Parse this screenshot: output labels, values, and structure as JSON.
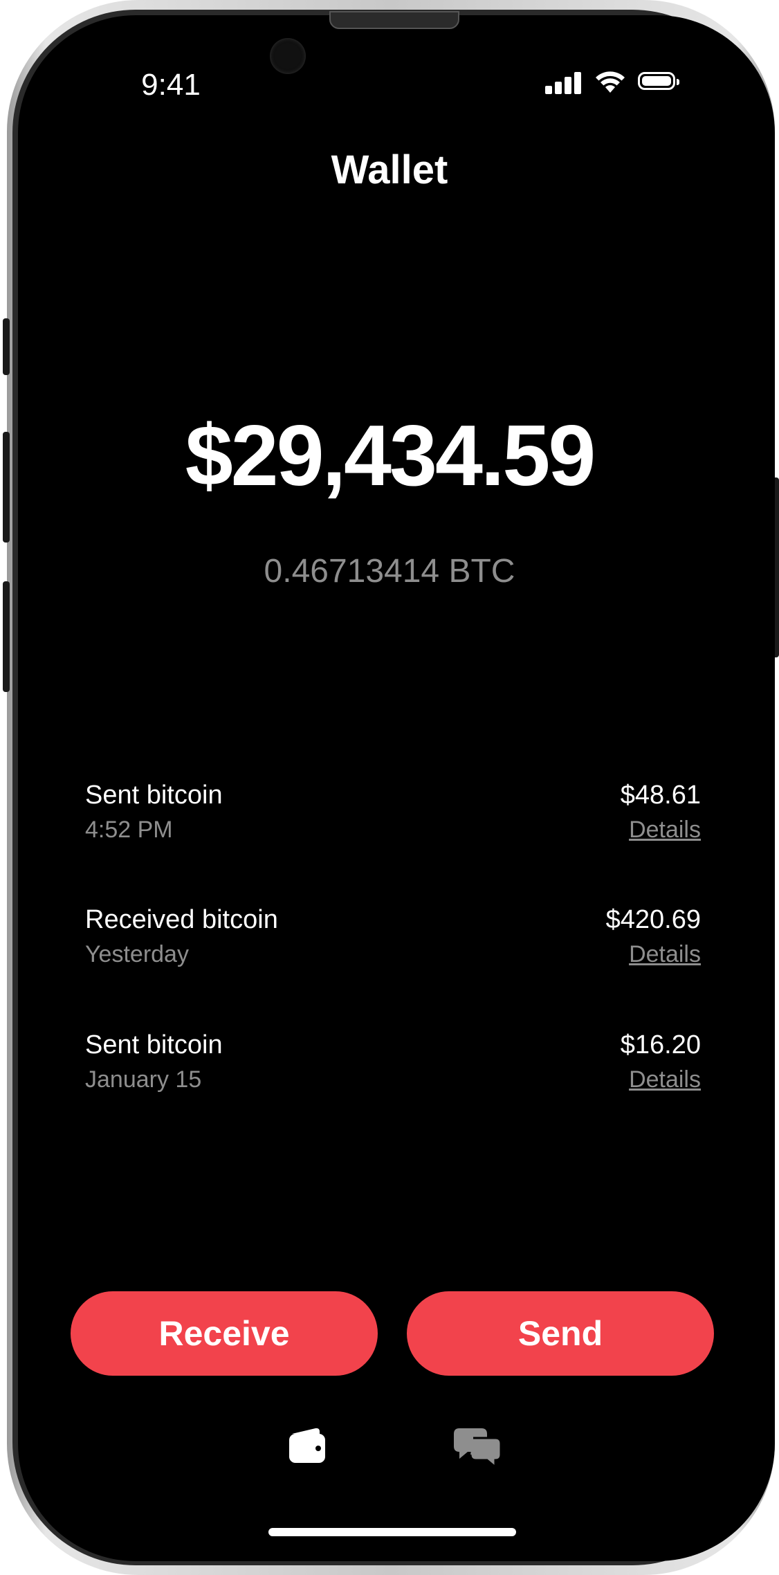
{
  "status_bar": {
    "time": "9:41"
  },
  "header": {
    "title": "Wallet"
  },
  "balance": {
    "usd": "$29,434.59",
    "btc": "0.46713414 BTC"
  },
  "transactions": [
    {
      "label": "Sent bitcoin",
      "date": "4:52 PM",
      "amount": "$48.61",
      "details": "Details"
    },
    {
      "label": "Received bitcoin",
      "date": "Yesterday",
      "amount": "$420.69",
      "details": "Details"
    },
    {
      "label": "Sent bitcoin",
      "date": "January 15",
      "amount": "$16.20",
      "details": "Details"
    }
  ],
  "actions": {
    "receive": "Receive",
    "send": "Send"
  },
  "tab_bar": {
    "icons": [
      "wallet-icon",
      "chat-icon"
    ]
  },
  "colors": {
    "accent": "#f2434c",
    "background": "#000000",
    "muted": "#8e8e8e"
  }
}
